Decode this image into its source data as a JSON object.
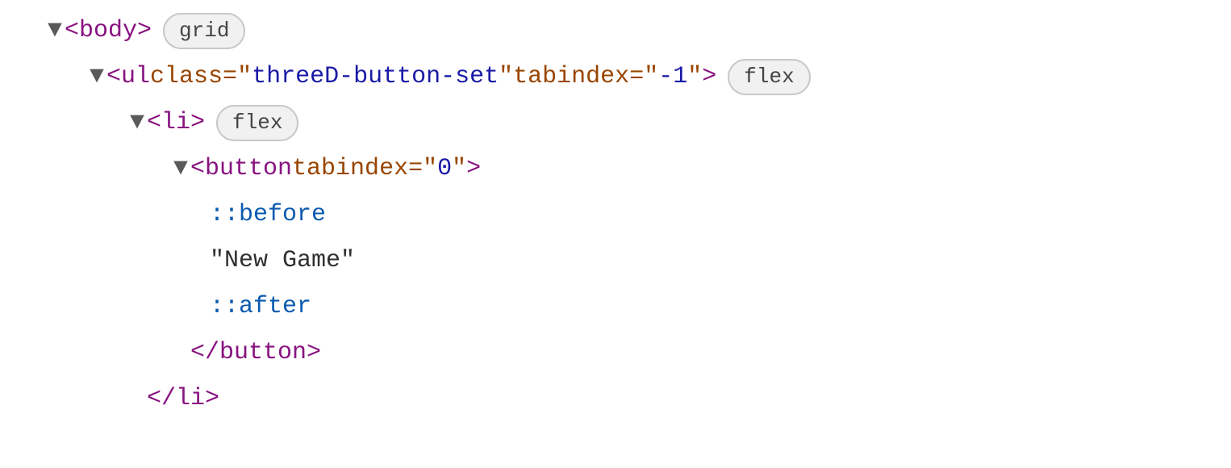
{
  "tree": {
    "row1": {
      "open": "<",
      "tag": "body",
      "close": ">",
      "badge": "grid"
    },
    "row2": {
      "open": "<",
      "tag": "ul",
      "sp": " ",
      "attr1_name": "class",
      "eq": "=",
      "q": "\"",
      "attr1_val": "threeD-button-set",
      "attr2_name": "tabindex",
      "attr2_val": "-1",
      "close": ">",
      "badge": "flex"
    },
    "row3": {
      "open": "<",
      "tag": "li",
      "close": ">",
      "badge": "flex"
    },
    "row4": {
      "open": "<",
      "tag": "button",
      "sp": " ",
      "attr1_name": "tabindex",
      "eq": "=",
      "q": "\"",
      "attr1_val": "0",
      "close": ">"
    },
    "row5": {
      "pseudo": "::before"
    },
    "row6": {
      "text": "\"New Game\""
    },
    "row7": {
      "pseudo": "::after"
    },
    "row8": {
      "open": "</",
      "tag": "button",
      "close": ">"
    },
    "row9": {
      "open": "</",
      "tag": "li",
      "close": ">"
    }
  }
}
